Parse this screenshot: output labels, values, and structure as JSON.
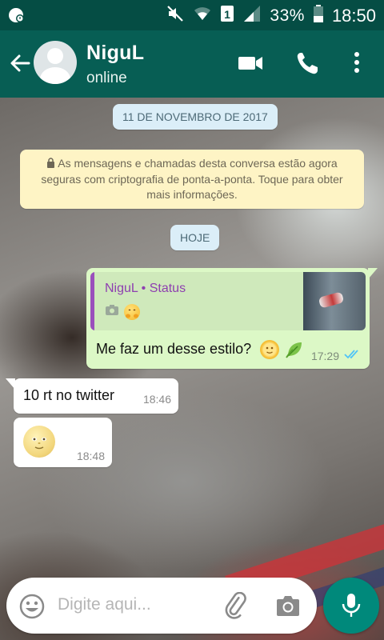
{
  "status_bar": {
    "battery_percent": "33%",
    "time": "18:50",
    "icons": [
      "notification-icon",
      "mute-icon",
      "wifi-icon",
      "sim-icon",
      "signal-icon",
      "battery-icon"
    ]
  },
  "app_bar": {
    "contact_name": "NiguL",
    "contact_status": "online",
    "icons": [
      "back-arrow-icon",
      "avatar",
      "video-call-icon",
      "phone-icon",
      "more-vert-icon"
    ]
  },
  "chat": {
    "date_pill": "11 DE NOVEMBRO DE 2017",
    "encryption_notice": "As mensagens e chamadas desta conversa estão agora seguras com criptografia de ponta-a-ponta. Toque para obter mais informações.",
    "today_pill": "HOJE",
    "messages": [
      {
        "direction": "outgoing",
        "quote": {
          "name": "NiguL • Status",
          "icons": [
            "camera-icon",
            "emoji-icon"
          ]
        },
        "text": "Me faz um desse estilo?",
        "time": "17:29",
        "status": "read",
        "status_color": "#4fc3f7"
      },
      {
        "direction": "incoming",
        "text": "10 rt no twitter",
        "time": "18:46"
      },
      {
        "direction": "incoming",
        "text": "",
        "sticker": "moon-face-emoji",
        "time": "18:48"
      }
    ]
  },
  "composer": {
    "placeholder": "Digite aqui...",
    "icons": [
      "emoji-icon",
      "attach-icon",
      "camera-icon",
      "mic-icon"
    ]
  },
  "colors": {
    "header": "#075e54",
    "status_bar": "#054d44",
    "outgoing_bubble": "#dcf8c6",
    "incoming_bubble": "#ffffff",
    "notice_bg": "#fef4c5",
    "pill_bg": "#dbeef8",
    "fab": "#00897b",
    "quote_name": "#8e3fb0"
  }
}
